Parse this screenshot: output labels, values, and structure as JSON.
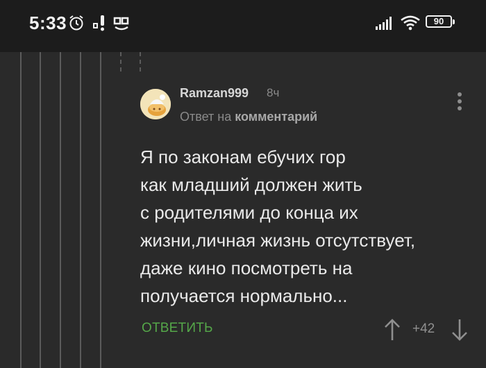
{
  "status_bar": {
    "time": "5:33",
    "icons": [
      "alarm-icon",
      "notification-icon",
      "app-icon",
      "signal-icon",
      "wifi-icon"
    ],
    "battery": "90"
  },
  "comment": {
    "username": "Ramzan999",
    "time_ago": "8ч",
    "reply_prefix": "Ответ на",
    "reply_target": "комментарий",
    "body_lines": [
      "Я по законам ебучих гор",
      "как младший должен жить",
      "с родителями до конца их",
      "жизни,личная жизнь отсутствует,",
      "даже кино посмотреть на",
      "получается нормально..."
    ],
    "reply_label": "ОТВЕТИТЬ",
    "rating": "+42"
  },
  "colors": {
    "background": "#2a2a2a",
    "status_bar": "#1c1c1c",
    "accent_green": "#55a849",
    "text_primary": "#e9e9e9",
    "text_secondary": "#8a8a8a"
  }
}
